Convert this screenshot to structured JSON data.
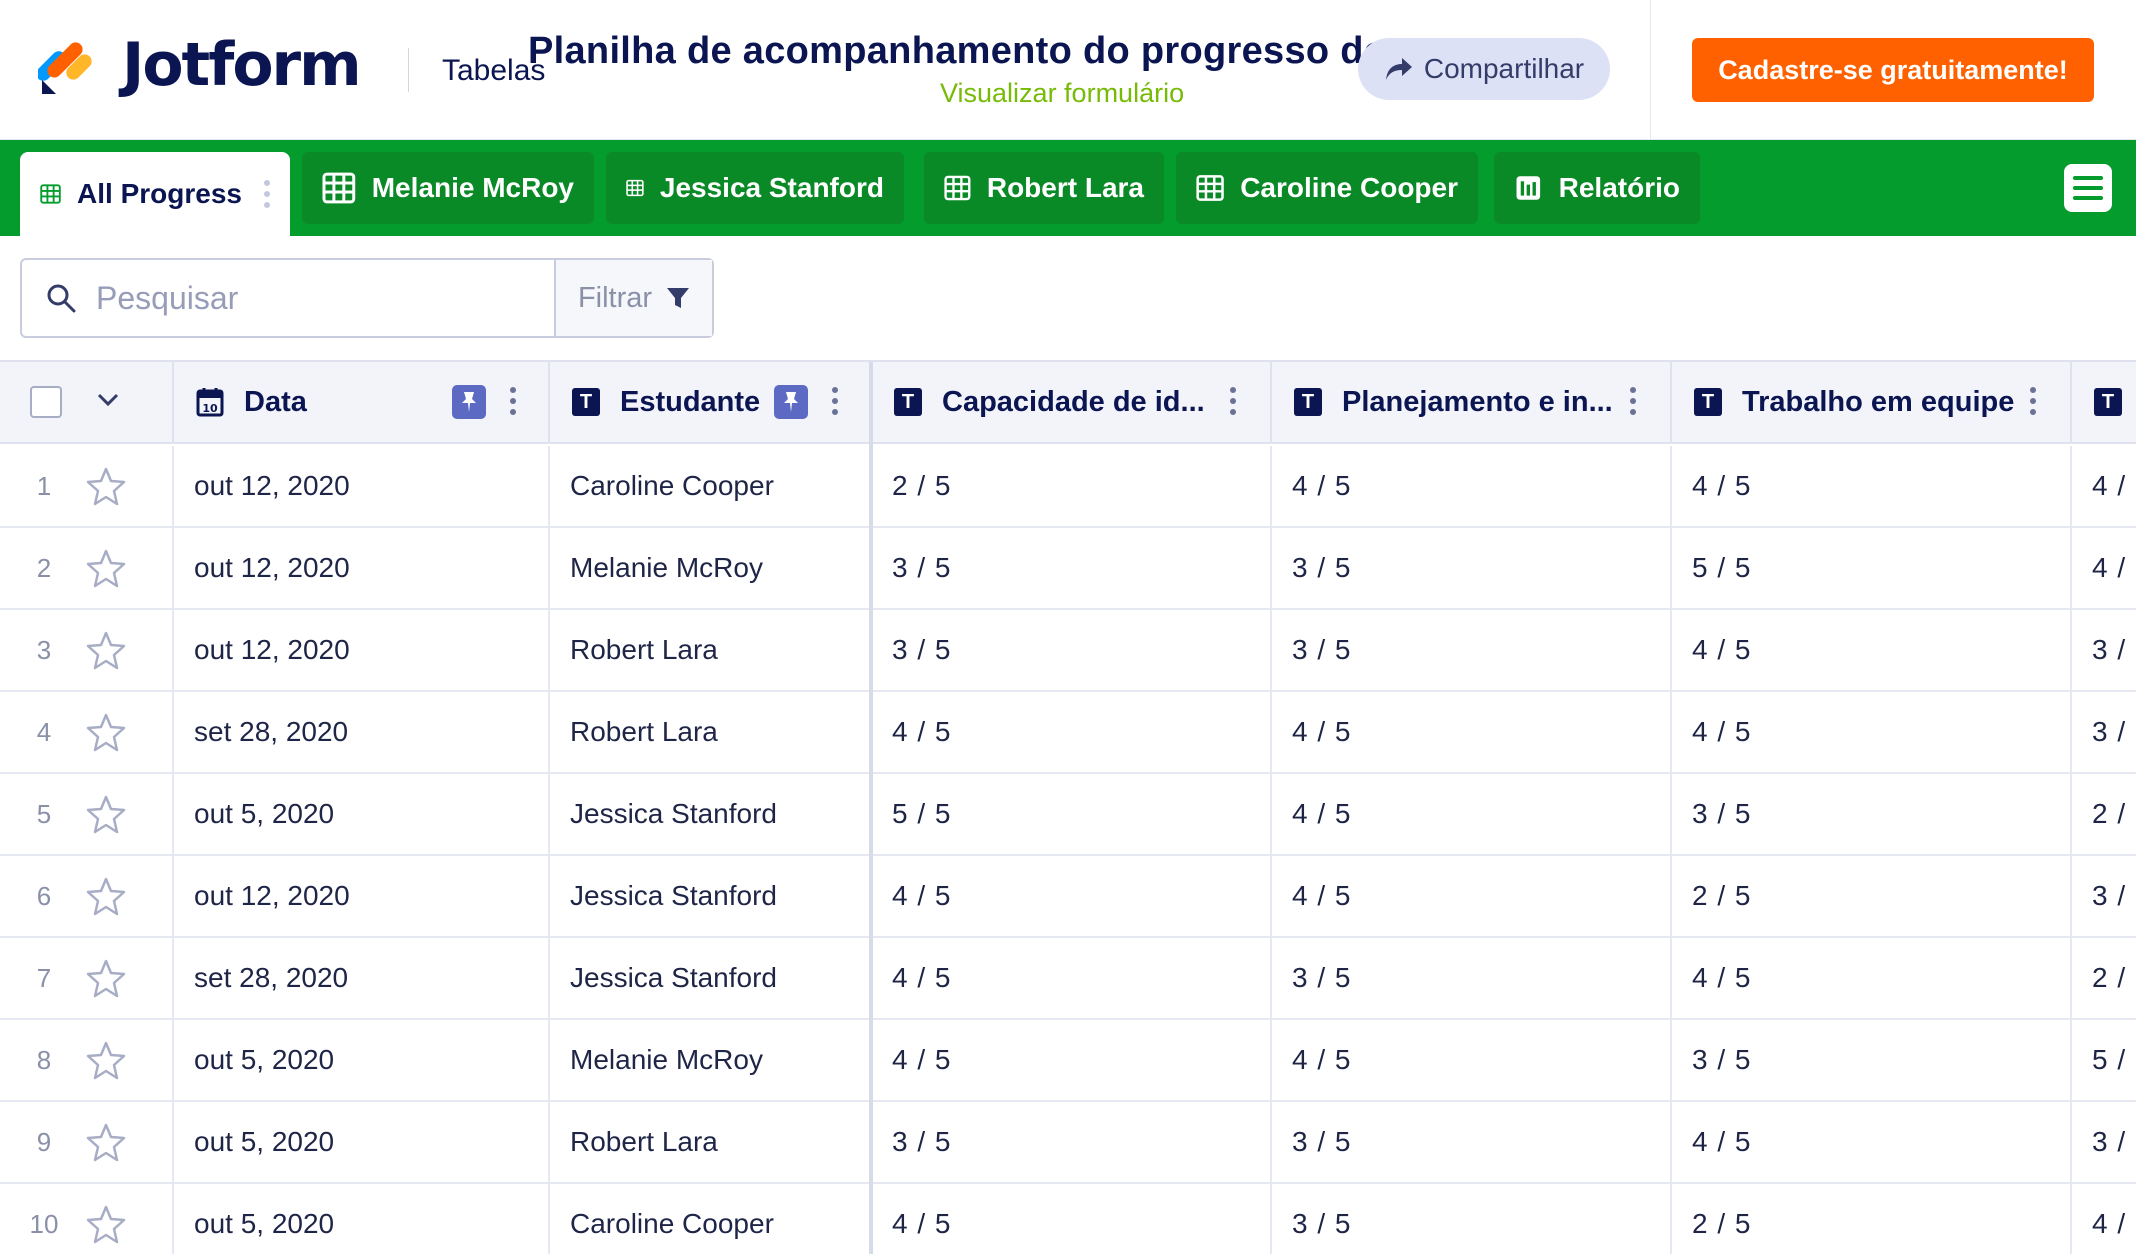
{
  "header": {
    "brand": "Jotform",
    "section": "Tabelas",
    "title": "Planilha de acompanhamento do progresso do estudante",
    "view_form": "Visualizar formulário",
    "share": "Compartilhar",
    "signup": "Cadastre-se gratuitamente!"
  },
  "colors": {
    "tab_bar": "#049c2c",
    "signup": "#ff6100",
    "view_form": "#78bb07",
    "navy": "#0a1551",
    "pin": "#5d6ac4"
  },
  "tabs": [
    {
      "label": "All Progress",
      "icon": "grid-icon",
      "active": true
    },
    {
      "label": "Melanie McRoy",
      "icon": "grid-icon"
    },
    {
      "label": "Jessica Stanford",
      "icon": "grid-icon"
    },
    {
      "label": "Robert Lara",
      "icon": "grid-icon"
    },
    {
      "label": "Caroline Cooper",
      "icon": "grid-icon"
    },
    {
      "label": "Relatório",
      "icon": "report-icon"
    }
  ],
  "search": {
    "placeholder": "Pesquisar",
    "filter": "Filtrar"
  },
  "columns": [
    {
      "label": "Data",
      "icon": "calendar-icon",
      "pinned": true
    },
    {
      "label": "Estudante",
      "icon": "text-icon",
      "pinned": true
    },
    {
      "label": "Capacidade de id...",
      "icon": "text-icon"
    },
    {
      "label": "Planejamento e in...",
      "icon": "text-icon"
    },
    {
      "label": "Trabalho em equipe",
      "icon": "text-icon"
    },
    {
      "label": "",
      "icon": "text-icon"
    }
  ],
  "rows": [
    {
      "index": "1",
      "data": "out 12, 2020",
      "estudante": "Caroline Cooper",
      "c1": "2 / 5",
      "c2": "4 / 5",
      "c3": "4 / 5",
      "c4": "4 /"
    },
    {
      "index": "2",
      "data": "out 12, 2020",
      "estudante": "Melanie McRoy",
      "c1": "3 / 5",
      "c2": "3 / 5",
      "c3": "5 / 5",
      "c4": "4 /"
    },
    {
      "index": "3",
      "data": "out 12, 2020",
      "estudante": "Robert Lara",
      "c1": "3 / 5",
      "c2": "3 / 5",
      "c3": "4 / 5",
      "c4": "3 /"
    },
    {
      "index": "4",
      "data": "set 28, 2020",
      "estudante": "Robert Lara",
      "c1": "4 / 5",
      "c2": "4 / 5",
      "c3": "4 / 5",
      "c4": "3 /"
    },
    {
      "index": "5",
      "data": "out 5, 2020",
      "estudante": "Jessica Stanford",
      "c1": "5 / 5",
      "c2": "4 / 5",
      "c3": "3 / 5",
      "c4": "2 /"
    },
    {
      "index": "6",
      "data": "out 12, 2020",
      "estudante": "Jessica Stanford",
      "c1": "4 / 5",
      "c2": "4 / 5",
      "c3": "2 / 5",
      "c4": "3 /"
    },
    {
      "index": "7",
      "data": "set 28, 2020",
      "estudante": "Jessica Stanford",
      "c1": "4 / 5",
      "c2": "3 / 5",
      "c3": "4 / 5",
      "c4": "2 /"
    },
    {
      "index": "8",
      "data": "out 5, 2020",
      "estudante": "Melanie McRoy",
      "c1": "4 / 5",
      "c2": "4 / 5",
      "c3": "3 / 5",
      "c4": "5 /"
    },
    {
      "index": "9",
      "data": "out 5, 2020",
      "estudante": "Robert Lara",
      "c1": "3 / 5",
      "c2": "3 / 5",
      "c3": "4 / 5",
      "c4": "3 /"
    },
    {
      "index": "10",
      "data": "out 5, 2020",
      "estudante": "Caroline Cooper",
      "c1": "4 / 5",
      "c2": "3 / 5",
      "c3": "2 / 5",
      "c4": "4 /"
    }
  ]
}
